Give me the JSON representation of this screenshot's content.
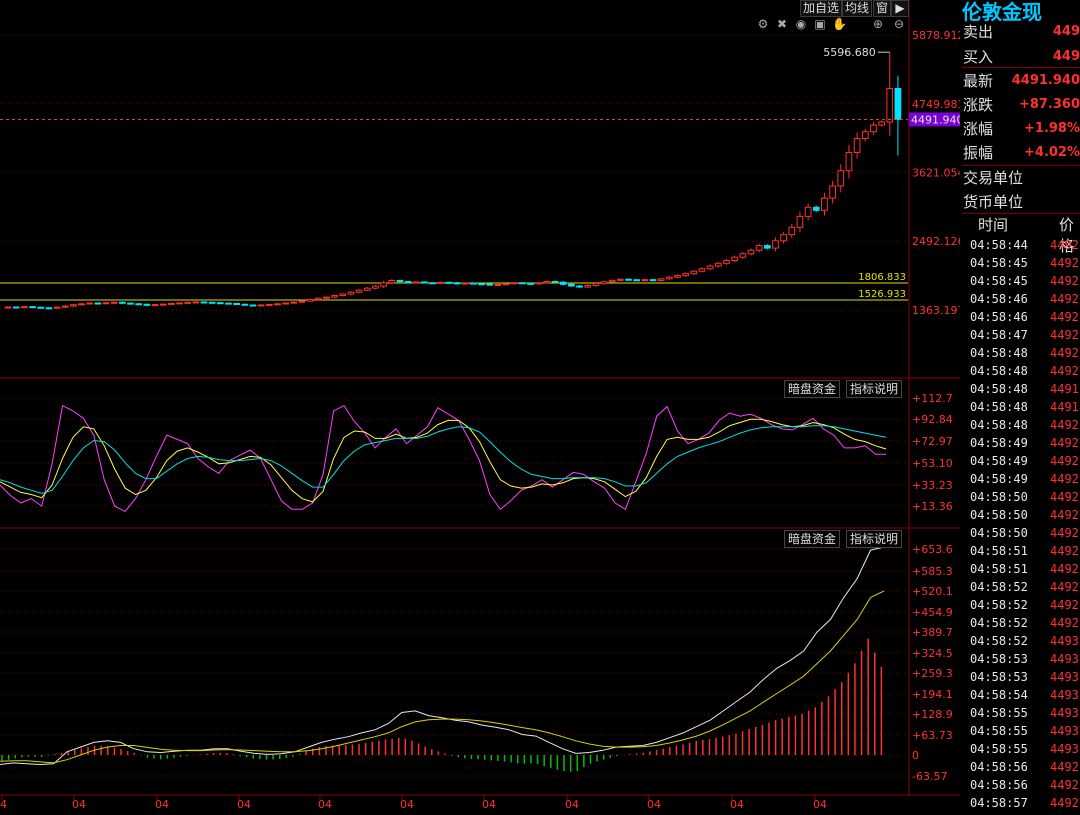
{
  "toolbar": {
    "buttons": [
      "加自选",
      "均线",
      "窗"
    ],
    "arrow_icon": "arrow-right-icon",
    "chart_icons": [
      "gear-icon",
      "delete-icon",
      "eye-icon",
      "camera-icon",
      "hand-icon",
      "zoom-in-icon",
      "zoom-out-icon"
    ]
  },
  "indicator_buttons": {
    "secret_money": "暗盘资金",
    "indicator_help": "指标说明"
  },
  "colors": {
    "up": "#ff3030",
    "down": "#00e5ff",
    "grid": "#7a0000",
    "axis_text": "#ff3030",
    "highlight_price_bg": "#7b00d4",
    "level_line": "#e0e000",
    "title": "#00c8ff"
  },
  "price_panel": {
    "axis_labels": [
      "5878.912",
      "4749.983",
      "3621.054",
      "2492.126",
      "1363.197"
    ],
    "current_price_tag": "4491.940",
    "max_annotation": "5596.680",
    "levels": [
      "1806.833",
      "1526.933"
    ]
  },
  "osc_panel": {
    "axis_labels": [
      "+112.7",
      "+92.84",
      "+72.97",
      "+53.10",
      "+33.23",
      "+13.36"
    ]
  },
  "macd_panel": {
    "axis_labels": [
      "+653.6",
      "+585.3",
      "+520.1",
      "+454.9",
      "+389.7",
      "+324.5",
      "+259.3",
      "+194.1",
      "+128.9",
      "+63.73",
      "0",
      "-63.57"
    ]
  },
  "x_axis_labels": [
    "4",
    "04",
    "04",
    "04",
    "04",
    "04",
    "04",
    "04",
    "04",
    "04",
    "04"
  ],
  "quote": {
    "title": "伦敦金现",
    "rows": [
      {
        "label": "卖出",
        "value": "449"
      },
      {
        "label": "买入",
        "value": "449"
      },
      {
        "label": "最新",
        "value": "4491.940"
      },
      {
        "label": "涨跌",
        "value": "+87.360"
      },
      {
        "label": "涨幅",
        "value": "+1.98%"
      },
      {
        "label": "振幅",
        "value": "+4.02%"
      }
    ],
    "trade_unit_label": "交易单位",
    "currency_unit_label": "货币单位",
    "ticks_header": {
      "time": "时间",
      "price": "价格"
    },
    "ticks": [
      {
        "time": "04:58:44",
        "price": "4492"
      },
      {
        "time": "04:58:45",
        "price": "4492"
      },
      {
        "time": "04:58:45",
        "price": "4492"
      },
      {
        "time": "04:58:46",
        "price": "4492"
      },
      {
        "time": "04:58:46",
        "price": "4492"
      },
      {
        "time": "04:58:47",
        "price": "4492"
      },
      {
        "time": "04:58:48",
        "price": "4492"
      },
      {
        "time": "04:58:48",
        "price": "4492"
      },
      {
        "time": "04:58:48",
        "price": "4491"
      },
      {
        "time": "04:58:48",
        "price": "4491"
      },
      {
        "time": "04:58:48",
        "price": "4492"
      },
      {
        "time": "04:58:49",
        "price": "4492"
      },
      {
        "time": "04:58:49",
        "price": "4492"
      },
      {
        "time": "04:58:49",
        "price": "4492"
      },
      {
        "time": "04:58:50",
        "price": "4492"
      },
      {
        "time": "04:58:50",
        "price": "4492"
      },
      {
        "time": "04:58:50",
        "price": "4492"
      },
      {
        "time": "04:58:51",
        "price": "4492"
      },
      {
        "time": "04:58:51",
        "price": "4492"
      },
      {
        "time": "04:58:52",
        "price": "4492"
      },
      {
        "time": "04:58:52",
        "price": "4492"
      },
      {
        "time": "04:58:52",
        "price": "4492"
      },
      {
        "time": "04:58:52",
        "price": "4493"
      },
      {
        "time": "04:58:53",
        "price": "4493"
      },
      {
        "time": "04:58:53",
        "price": "4493"
      },
      {
        "time": "04:58:54",
        "price": "4493"
      },
      {
        "time": "04:58:55",
        "price": "4493"
      },
      {
        "time": "04:58:55",
        "price": "4493"
      },
      {
        "time": "04:58:55",
        "price": "4493"
      },
      {
        "time": "04:58:56",
        "price": "4492"
      },
      {
        "time": "04:58:56",
        "price": "4492"
      },
      {
        "time": "04:58:57",
        "price": "4492"
      }
    ]
  },
  "chart_data": [
    {
      "type": "candlestick",
      "ylim": [
        1363.197,
        5878.912
      ],
      "close": [
        1412,
        1405,
        1418,
        1408,
        1400,
        1395,
        1410,
        1428,
        1450,
        1465,
        1478,
        1470,
        1482,
        1490,
        1476,
        1466,
        1458,
        1440,
        1452,
        1460,
        1471,
        1480,
        1489,
        1495,
        1490,
        1483,
        1476,
        1470,
        1458,
        1445,
        1438,
        1446,
        1455,
        1465,
        1478,
        1492,
        1509,
        1535,
        1556,
        1575,
        1600,
        1625,
        1655,
        1688,
        1722,
        1755,
        1810,
        1848,
        1830,
        1812,
        1823,
        1810,
        1800,
        1818,
        1810,
        1792,
        1805,
        1795,
        1788,
        1775,
        1782,
        1795,
        1810,
        1800,
        1791,
        1810,
        1832,
        1819,
        1785,
        1758,
        1740,
        1765,
        1800,
        1828,
        1850,
        1868,
        1860,
        1850,
        1861,
        1849,
        1875,
        1902,
        1928,
        1960,
        2000,
        2040,
        2085,
        2130,
        2175,
        2230,
        2286,
        2345,
        2420,
        2380,
        2500,
        2600,
        2720,
        2900,
        3050,
        3000,
        3200,
        3400,
        3650,
        3950,
        4180,
        4290,
        4400,
        4450,
        5000,
        4491.94
      ],
      "high_max": 5596.68
    },
    {
      "type": "line",
      "ylim": [
        0,
        120
      ],
      "series": [
        {
          "color": "#ff40ff",
          "values": [
            35,
            25,
            18,
            22,
            15,
            55,
            110,
            105,
            98,
            82,
            40,
            15,
            10,
            22,
            40,
            62,
            82,
            78,
            74,
            60,
            52,
            46,
            58,
            63,
            68,
            60,
            40,
            20,
            12,
            12,
            18,
            45,
            105,
            110,
            95,
            84,
            70,
            80,
            88,
            74,
            82,
            90,
            108,
            102,
            96,
            78,
            58,
            26,
            12,
            20,
            30,
            34,
            40,
            33,
            40,
            47,
            45,
            38,
            32,
            18,
            12,
            38,
            65,
            100,
            109,
            86,
            74,
            78,
            84,
            96,
            103,
            100,
            102,
            98,
            92,
            88,
            87,
            92,
            98,
            88,
            82,
            70,
            70,
            72,
            64,
            64
          ]
        },
        {
          "color": "#ffff40",
          "values": [
            38,
            33,
            28,
            26,
            23,
            35,
            60,
            80,
            90,
            88,
            72,
            50,
            32,
            26,
            30,
            42,
            58,
            67,
            70,
            66,
            61,
            55,
            56,
            59,
            62,
            61,
            54,
            42,
            30,
            22,
            19,
            29,
            60,
            80,
            86,
            85,
            79,
            79,
            83,
            79,
            80,
            84,
            92,
            96,
            96,
            89,
            76,
            57,
            40,
            34,
            32,
            33,
            36,
            35,
            37,
            41,
            42,
            41,
            38,
            31,
            24,
            29,
            42,
            62,
            78,
            80,
            78,
            78,
            80,
            85,
            91,
            94,
            97,
            97,
            95,
            92,
            90,
            91,
            94,
            92,
            89,
            83,
            78,
            76,
            72,
            69
          ]
        },
        {
          "color": "#00e0e0",
          "values": [
            40,
            37,
            33,
            30,
            27,
            30,
            43,
            58,
            70,
            77,
            76,
            68,
            56,
            46,
            41,
            41,
            48,
            55,
            60,
            62,
            61,
            59,
            58,
            58,
            59,
            60,
            58,
            53,
            46,
            39,
            33,
            33,
            45,
            58,
            67,
            73,
            75,
            77,
            79,
            79,
            79,
            81,
            85,
            88,
            90,
            89,
            85,
            76,
            66,
            57,
            50,
            45,
            43,
            41,
            41,
            42,
            42,
            42,
            41,
            38,
            34,
            34,
            37,
            46,
            55,
            62,
            66,
            70,
            73,
            76,
            80,
            84,
            87,
            89,
            90,
            90,
            90,
            90,
            91,
            91,
            90,
            88,
            86,
            84,
            82,
            80
          ]
        }
      ]
    },
    {
      "type": "line+bar",
      "ylim": [
        -63.57,
        653.6
      ],
      "series": [
        {
          "color": "#e8e8e8",
          "name": "",
          "values": [
            -30,
            -25,
            -28,
            -30,
            -28,
            10,
            25,
            40,
            45,
            40,
            20,
            10,
            8,
            12,
            15,
            15,
            20,
            20,
            12,
            5,
            2,
            4,
            10,
            25,
            40,
            50,
            58,
            70,
            80,
            100,
            135,
            140,
            125,
            118,
            110,
            105,
            95,
            88,
            80,
            65,
            60,
            40,
            20,
            5,
            8,
            15,
            25,
            28,
            30,
            40,
            55,
            70,
            90,
            110,
            140,
            170,
            200,
            240,
            275,
            300,
            330,
            390,
            430,
            500,
            560,
            650,
            660
          ]
        },
        {
          "color": "#d4d400",
          "name": "",
          "values": [
            -20,
            -18,
            -18,
            -22,
            -25,
            -15,
            0,
            15,
            25,
            30,
            30,
            24,
            18,
            15,
            14,
            14,
            16,
            17,
            16,
            14,
            12,
            10,
            10,
            14,
            20,
            28,
            38,
            48,
            58,
            70,
            90,
            105,
            112,
            114,
            114,
            112,
            108,
            102,
            95,
            87,
            80,
            70,
            58,
            45,
            35,
            28,
            25,
            25,
            26,
            30,
            38,
            48,
            60,
            76,
            96,
            118,
            140,
            168,
            195,
            222,
            250,
            290,
            330,
            380,
            430,
            500,
            520
          ]
        },
        {
          "color": "#ff3030",
          "name": "",
          "values": [
            -20,
            -10,
            -5,
            -6,
            3,
            12,
            22,
            30,
            28,
            18,
            5,
            -10,
            -14,
            -8,
            -2,
            2,
            7,
            6,
            -5,
            -12,
            -15,
            -12,
            -4,
            16,
            28,
            30,
            32,
            36,
            44,
            50,
            55,
            42,
            22,
            8,
            -6,
            -12,
            -14,
            -18,
            -22,
            -28,
            -26,
            -40,
            -50,
            -55,
            -30,
            -16,
            -5,
            2,
            6,
            14,
            24,
            32,
            44,
            50,
            58,
            66,
            82,
            94,
            110,
            120,
            130,
            150,
            185,
            230,
            290,
            370,
            280
          ]
        }
      ]
    }
  ]
}
